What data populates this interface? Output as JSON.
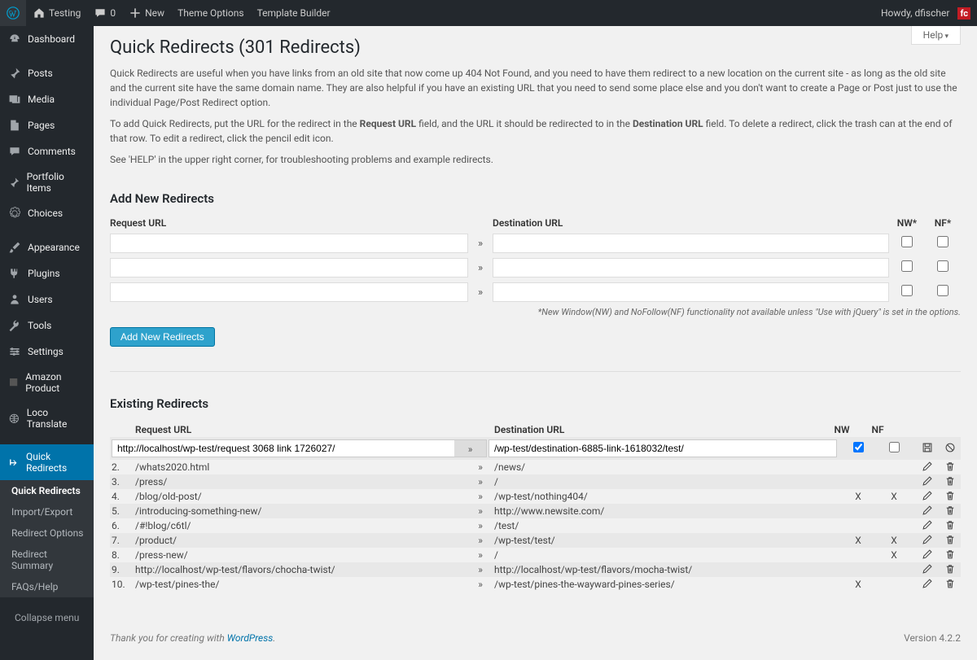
{
  "adminbar": {
    "site": "Testing",
    "comments": "0",
    "new": "New",
    "theme_options": "Theme Options",
    "template_builder": "Template Builder",
    "howdy": "Howdy, dfischer",
    "fc": "fc"
  },
  "sidebar": {
    "items": [
      {
        "label": "Dashboard",
        "icon": "dashboard"
      },
      {
        "label": "Posts",
        "icon": "pin"
      },
      {
        "label": "Media",
        "icon": "media"
      },
      {
        "label": "Pages",
        "icon": "page"
      },
      {
        "label": "Comments",
        "icon": "comment"
      },
      {
        "label": "Portfolio Items",
        "icon": "portfolio"
      },
      {
        "label": "Choices",
        "icon": "gear"
      },
      {
        "label": "Appearance",
        "icon": "brush"
      },
      {
        "label": "Plugins",
        "icon": "plug"
      },
      {
        "label": "Users",
        "icon": "user"
      },
      {
        "label": "Tools",
        "icon": "wrench"
      },
      {
        "label": "Settings",
        "icon": "sliders"
      },
      {
        "label": "Amazon Product",
        "icon": "az"
      },
      {
        "label": "Loco Translate",
        "icon": "globe"
      },
      {
        "label": "Quick Redirects",
        "icon": "redirect",
        "current": true
      }
    ],
    "submenu": [
      {
        "label": "Quick Redirects",
        "current": true
      },
      {
        "label": "Import/Export"
      },
      {
        "label": "Redirect Options"
      },
      {
        "label": "Redirect Summary"
      },
      {
        "label": "FAQs/Help"
      }
    ],
    "collapse": "Collapse menu"
  },
  "page": {
    "help": "Help",
    "title": "Quick Redirects (301 Redirects)",
    "intro1": "Quick Redirects are useful when you have links from an old site that now come up 404 Not Found, and you need to have them redirect to a new location on the current site - as long as the old site and the current site have the same domain name. They are also helpful if you have an existing URL that you need to send some place else and you don't want to create a Page or Post just to use the individual Page/Post Redirect option.",
    "intro2a": "To add Quick Redirects, put the URL for the redirect in the ",
    "intro2b": "Request URL",
    "intro2c": " field, and the URL it should be redirected to in the ",
    "intro2d": "Destination URL",
    "intro2e": " field. To delete a redirect, click the trash can at the end of that row. To edit a redirect, click the pencil edit icon.",
    "intro3": "See 'HELP' in the upper right corner, for troubleshooting problems and example redirects."
  },
  "add": {
    "heading": "Add New Redirects",
    "col_request": "Request URL",
    "col_destination": "Destination URL",
    "col_nw": "NW*",
    "col_nf": "NF*",
    "note": "*New Window(NW) and NoFollow(NF) functionality not available unless \"Use with jQuery\" is set in the options.",
    "button": "Add New Redirects"
  },
  "existing": {
    "heading": "Existing Redirects",
    "col_request": "Request URL",
    "col_destination": "Destination URL",
    "col_nw": "NW",
    "col_nf": "NF",
    "edit": {
      "request": "http://localhost/wp-test/request 3068 link 1726027/",
      "destination": "/wp-test/destination-6885-link-1618032/test/",
      "nw": true,
      "nf": false
    },
    "rows": [
      {
        "n": "2.",
        "req": "/whats2020.html",
        "dest": "/news/",
        "nw": "",
        "nf": ""
      },
      {
        "n": "3.",
        "req": "/press/",
        "dest": "/",
        "nw": "",
        "nf": ""
      },
      {
        "n": "4.",
        "req": "/blog/old-post/",
        "dest": "/wp-test/nothing404/",
        "nw": "X",
        "nf": "X"
      },
      {
        "n": "5.",
        "req": "/introducing-something-new/",
        "dest": "http://www.newsite.com/",
        "nw": "",
        "nf": ""
      },
      {
        "n": "6.",
        "req": "/#!blog/c6tl/",
        "dest": "/test/",
        "nw": "",
        "nf": ""
      },
      {
        "n": "7.",
        "req": "/product/",
        "dest": "/wp-test/test/",
        "nw": "X",
        "nf": "X"
      },
      {
        "n": "8.",
        "req": "/press-new/",
        "dest": "/",
        "nw": "",
        "nf": "X"
      },
      {
        "n": "9.",
        "req": "http://localhost/wp-test/flavors/chocha-twist/",
        "dest": "http://localhost/wp-test/flavors/mocha-twist/",
        "nw": "",
        "nf": ""
      },
      {
        "n": "10.",
        "req": "/wp-test/pines-the/",
        "dest": "/wp-test/pines-the-wayward-pines-series/",
        "nw": "X",
        "nf": ""
      }
    ]
  },
  "footer": {
    "thanks_a": "Thank you for creating with ",
    "thanks_b": "WordPress",
    "version": "Version 4.2.2"
  }
}
